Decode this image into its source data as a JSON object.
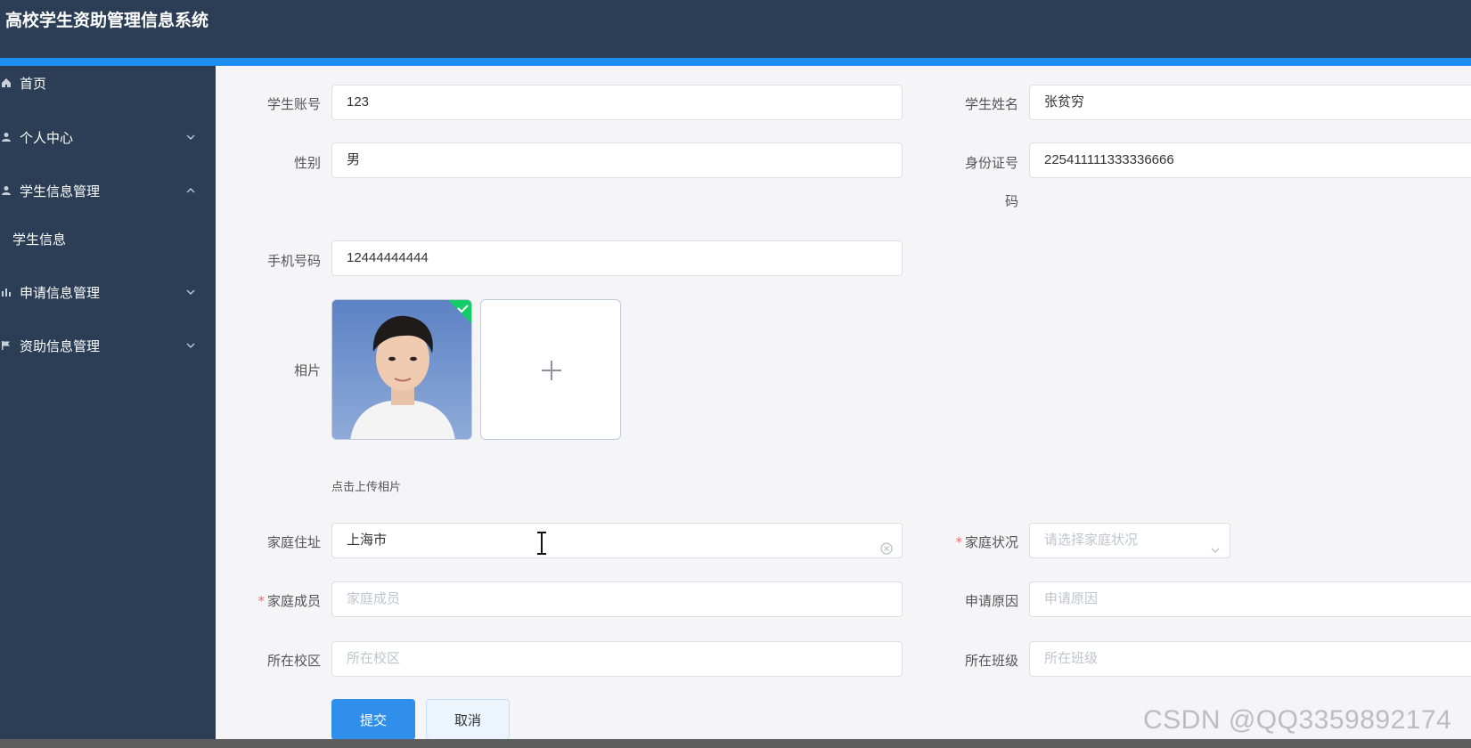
{
  "app": {
    "title": "高校学生资助管理信息系统"
  },
  "sidebar": {
    "items": [
      {
        "label": "首页",
        "icon": "home-icon"
      },
      {
        "label": "个人中心",
        "icon": "user-icon"
      },
      {
        "label": "学生信息管理",
        "icon": "user-icon",
        "expanded": true
      },
      {
        "label": "学生信息",
        "sub": true
      },
      {
        "label": "申请信息管理",
        "icon": "bar-chart-icon"
      },
      {
        "label": "资助信息管理",
        "icon": "flag-icon"
      }
    ]
  },
  "form": {
    "student_account": {
      "label": "学生账号",
      "value": "123"
    },
    "student_name": {
      "label": "学生姓名",
      "value": "张贫穷"
    },
    "gender": {
      "label": "性别",
      "value": "男"
    },
    "id_number": {
      "label_line1": "身份证号",
      "label_line2": "码",
      "value": "225411111333336666"
    },
    "phone": {
      "label": "手机号码",
      "value": "12444444444"
    },
    "photo": {
      "label": "相片",
      "hint": "点击上传相片"
    },
    "home_address": {
      "label": "家庭住址",
      "value": "上海市"
    },
    "family_status": {
      "required_mark": "*",
      "label": "家庭状况",
      "placeholder": "请选择家庭状况"
    },
    "family_members": {
      "required_mark": "*",
      "label": "家庭成员",
      "placeholder": "家庭成员"
    },
    "apply_reason": {
      "label": "申请原因",
      "placeholder": "申请原因"
    },
    "campus": {
      "label": "所在校区",
      "placeholder": "所在校区"
    },
    "class": {
      "label": "所在班级",
      "placeholder": "所在班级"
    }
  },
  "buttons": {
    "submit": "提交",
    "cancel": "取消"
  },
  "watermark": "CSDN @QQ3359892174",
  "colors": {
    "header": "#2c3e55",
    "accent": "#1f8ef1",
    "primary_button": "#2f8fea",
    "required": "#f56c6c"
  }
}
